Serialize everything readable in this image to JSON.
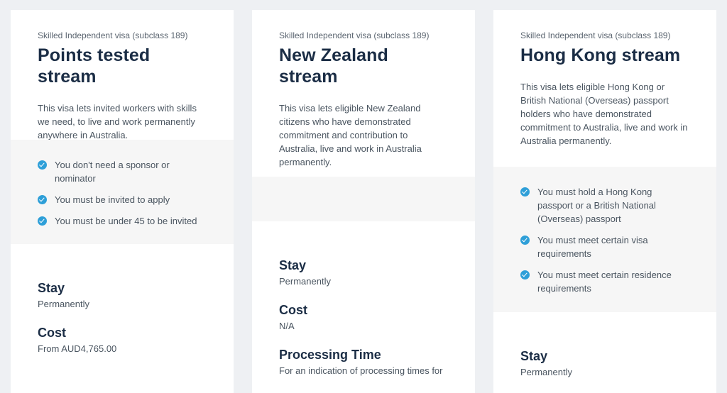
{
  "cards": [
    {
      "eyebrow": "Skilled Independent visa (subclass 189)",
      "title": "Points tested stream",
      "description": "This visa lets invited workers with skills we need, to live and work permanently anywhere in Australia.",
      "requirements": [
        "You don't need a sponsor or nominator",
        "You must be invited to apply",
        "You must be under 45 to be invited"
      ],
      "facts": {
        "stay_label": "Stay",
        "stay_value": "Permanently",
        "cost_label": "Cost",
        "cost_value": "From AUD4,765.00"
      }
    },
    {
      "eyebrow": "Skilled Independent visa (subclass 189)",
      "title": "New Zealand stream",
      "description": "This visa lets eligible New Zealand citizens who have demonstrated commitment and contribution to Australia, live and work in Australia permanently.",
      "requirements": [],
      "facts": {
        "stay_label": "Stay",
        "stay_value": "Permanently",
        "cost_label": "Cost",
        "cost_value": "N/A",
        "processing_label": "Processing Time",
        "processing_value": "For an indication of processing times for"
      }
    },
    {
      "eyebrow": "Skilled Independent visa (subclass 189)",
      "title": "Hong Kong stream",
      "description": "This visa lets eligible Hong Kong or British National (Overseas) passport holders who have demonstrated commitment to Australia, live and work in Australia permanently.",
      "requirements": [
        "You must hold a Hong Kong passport or a British National (Overseas) passport",
        "You must meet certain visa requirements",
        "You must meet certain residence requirements"
      ],
      "facts": {
        "stay_label": "Stay",
        "stay_value": "Permanently"
      }
    }
  ],
  "colors": {
    "page_background": "#eef0f3",
    "card_background": "#ffffff",
    "requirements_background": "#f6f6f6",
    "title_color": "#1b2d45",
    "check_icon_color": "#2e9fd8"
  },
  "icons": {
    "requirement_bullet": "check-circle-icon"
  }
}
